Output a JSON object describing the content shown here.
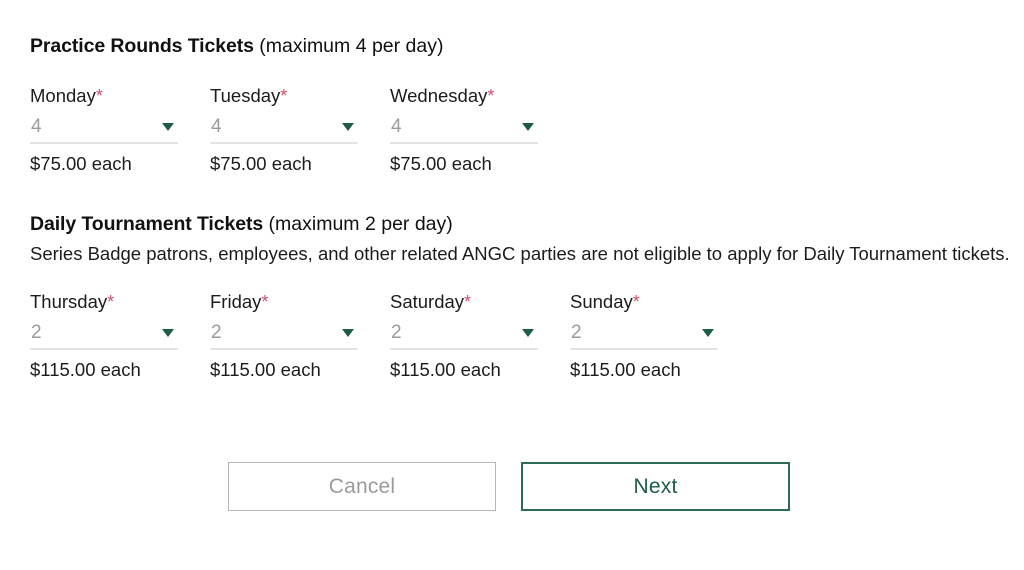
{
  "sections": [
    {
      "id": "practice-rounds",
      "heading_strong": "Practice Rounds Tickets",
      "heading_normal": " (maximum 4 per day)",
      "note": "",
      "fields": [
        {
          "label": "Monday",
          "required_mark": "*",
          "value": "4",
          "price": "$75.00 each"
        },
        {
          "label": "Tuesday",
          "required_mark": "*",
          "value": "4",
          "price": "$75.00 each"
        },
        {
          "label": "Wednesday",
          "required_mark": "*",
          "value": "4",
          "price": "$75.00 each"
        }
      ]
    },
    {
      "id": "daily-tournament",
      "heading_strong": "Daily Tournament Tickets",
      "heading_normal": " (maximum 2 per day)",
      "note": "Series Badge patrons, employees, and other related ANGC parties are not eligible to apply for Daily Tournament tickets.",
      "fields": [
        {
          "label": "Thursday",
          "required_mark": "*",
          "value": "2",
          "price": "$115.00 each"
        },
        {
          "label": "Friday",
          "required_mark": "*",
          "value": "2",
          "price": "$115.00 each"
        },
        {
          "label": "Saturday",
          "required_mark": "*",
          "value": "2",
          "price": "$115.00 each"
        },
        {
          "label": "Sunday",
          "required_mark": "*",
          "value": "2",
          "price": "$115.00 each"
        }
      ]
    }
  ],
  "buttons": {
    "cancel_label": "Cancel",
    "next_label": "Next"
  },
  "colors": {
    "accent_green": "#1d5c45",
    "next_border": "#2e6a58",
    "required_star": "#d14f6e",
    "cancel_text": "#9a9a9a",
    "cancel_border": "#b6b6b6",
    "select_value": "#9b9b9b",
    "underline": "#e4e4e4",
    "text": "#1c1c1c"
  }
}
